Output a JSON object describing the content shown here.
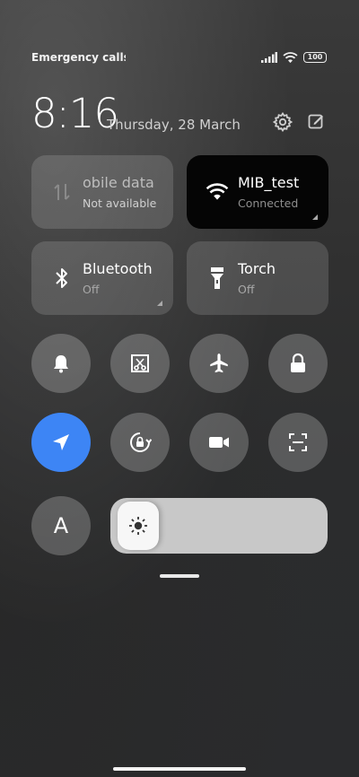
{
  "status_bar": {
    "carrier_text": "Emergency calls o",
    "battery": "100"
  },
  "header": {
    "time": "8:16",
    "date": "Thursday, 28 March"
  },
  "tiles": {
    "mobile_data": {
      "title": "obile data",
      "subtitle": "Not available",
      "state": "unavailable"
    },
    "wifi": {
      "title": "MIB_test",
      "subtitle": "Connected",
      "state": "on"
    },
    "bluetooth": {
      "title": "Bluetooth",
      "subtitle": "Off",
      "state": "off"
    },
    "torch": {
      "title": "Torch",
      "subtitle": "Off",
      "state": "off"
    }
  },
  "toggles_row1": [
    "bell-icon",
    "screenshot-icon",
    "airplane-icon",
    "lock-icon"
  ],
  "toggles_row2": [
    "location-icon",
    "rotation-lock-icon",
    "video-camera-icon",
    "scan-icon"
  ],
  "location_active": true,
  "auto_brightness": {
    "label": "A"
  },
  "brightness": {
    "level": 0.05
  },
  "colors": {
    "accent": "#3d85f5",
    "tile_bg": "rgba(255,255,255,0.14)",
    "active_tile_bg": "#050505"
  }
}
